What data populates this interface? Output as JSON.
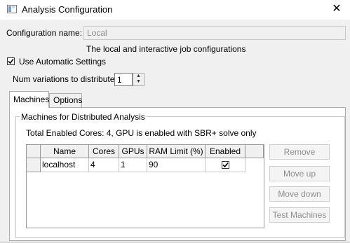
{
  "window": {
    "title": "Analysis Configuration",
    "close_glyph": "✕"
  },
  "config": {
    "name_label": "Configuration name:",
    "name_value": "Local",
    "description": "The local and interactive job configurations"
  },
  "auto_settings": {
    "label": "Use Automatic Settings",
    "checked": true
  },
  "variations": {
    "label": "Num variations to distribute:",
    "value": "1"
  },
  "tabs": [
    {
      "label": "Machines",
      "active": true
    },
    {
      "label": "Options",
      "active": false
    }
  ],
  "machines": {
    "group_title": "Machines for Distributed Analysis",
    "summary": "Total Enabled Cores: 4, GPU is enabled with SBR+ solve only",
    "columns": [
      "Name",
      "Cores",
      "GPUs",
      "RAM Limit (%)",
      "Enabled"
    ],
    "rows": [
      {
        "name": "localhost",
        "cores": "4",
        "gpus": "1",
        "ram": "90",
        "enabled": true
      }
    ]
  },
  "buttons": {
    "remove": "Remove",
    "move_up": "Move up",
    "move_down": "Move down",
    "test": "Test Machines"
  },
  "icons": [
    "app-icon",
    "close-icon",
    "checkmark-icon",
    "spin-up-icon",
    "spin-down-icon"
  ]
}
